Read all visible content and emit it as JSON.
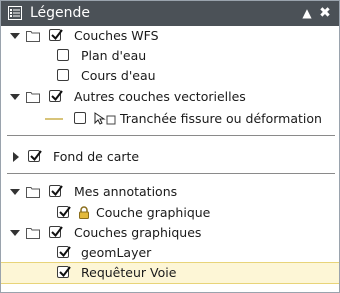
{
  "header": {
    "title": "Légende",
    "collapse_icon": "caret-up-icon",
    "close_icon": "close-icon"
  },
  "tree": {
    "couches_wfs": "Couches WFS",
    "plan_eau": "Plan d'eau",
    "cours_eau": "Cours d'eau",
    "autres_couches": "Autres couches vectorielles",
    "tranchee": "Tranchée fissure ou déformation",
    "fond_de_carte": "Fond de carte",
    "mes_annotations": "Mes annotations",
    "couche_graphique": "Couche graphique",
    "couches_graphiques": "Couches graphiques",
    "geomlayer": "geomLayer",
    "requeteur_voie": "Requêteur Voie"
  },
  "colors": {
    "header_bg": "#4b5157",
    "selection_bg": "#fdf6d6",
    "line_symbol": "#d8c47a"
  }
}
